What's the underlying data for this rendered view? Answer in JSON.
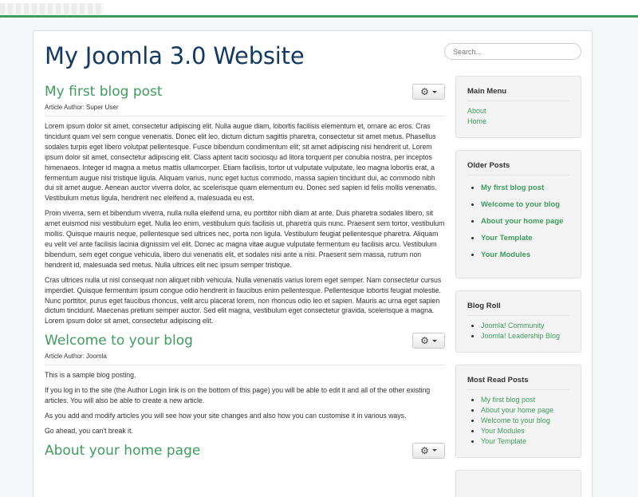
{
  "site": {
    "title": "My Joomla 3.0 Website"
  },
  "search": {
    "placeholder": "Search..."
  },
  "articles": [
    {
      "title": "My first blog post",
      "author": "Article Author: Super User",
      "paragraphs": [
        "Lorem ipsum dolor sit amet, consectetur adipiscing elit. Nulla augue diam, lobortis facilisis elementum et, ornare ac eros. Cras tincidunt quam vel sem congue venenatis. Donec elit leo, dictum dictum sagittis pharetra, consectetur sit amet metus. Phasellus sodales turpis eget libero volutpat pellentesque. Fusce bibendum condimentum elit; sit amet adipiscing nisi hendrerit ut. Lorem ipsum dolor sit amet, consectetur adipiscing elit. Class aptent taciti sociosqu ad litora torquent per conubia nostra, per inceptos himenaeos. Integer id magna a metus mattis ullamcorper. Etiam facilisis, tortor ut vulputate vulputate, leo magna lobortis erat, a fermentum augue nisi tristique ligula. Aliquam varius, nunc eget luctus commodo, massa sapien tincidunt dui, ac commodo nibh dui sit amet augue. Aenean auctor viverra dolor, ac scelerisque quam elementum eu. Donec sed sapien id felis mollis venenatis. Vestibulum metus ligula, hendrerit nec eleifend a, malesuada eu est.",
        "Proin viverra, sem et bibendum viverra, nulla nulla eleifend urna, eu porttitor nibh diam at ante. Duis pharetra sodales libero, sit amet euismod nisi vestibulum eget. Nulla leo enim, vestibulum quis facilisis ut, pharetra quis nunc. Praesent sem tortor, vestibulum mollis. Quisque mauris neque, pellentesque sed ultrices nec, porta non ligula. Vestibulum feugiat pellentesque pharetra. Aliquam eu velit vel ante facilisis lacinia dignissim vel elit. Donec ac magna vitae augue vulputate fermentum eu facilisis arcu. Vestibulum bibendum, sem eget congue vehicula, libero dui venenatis elit, et sodales nisi ante a nisi. Praesent sem massa, rutrum non hendrerit id, malesuada sed metus. Nulla ultrices elit nec ipsum semper tristique.",
        "Cras ultrices nulla ut nisl consequat non aliquet nibh vehicula. Nulla venenatis varius lorem eget semper. Nam consectetur cursus imperdiet. Quisque fermentum ipsum congue odio hendrerit in faucibus enim pellentesque. Pellentesque lobortis feugiat molestie. Nunc porttitor, purus eget faucibus rhoncus, velit arcu placerat lorem, non rhoncus odio leo et sapien. Mauris ac urna eget sapien dictum tincidunt. Maecenas pretium semper auctor. Sed elit magna, vestibulum eget consectetur gravida, scelerisque a magna. Lorem ipsum dolor sit amet, consectetur adipiscing elit."
      ]
    },
    {
      "title": "Welcome to your blog",
      "author": "Article Author: Joomla",
      "paragraphs": [
        "This is a sample blog posting.",
        "If you log in to the site (the Author Login link is on the bottom of this page) you will be able to edit it and all of the other existing articles. You will also be able to create a new article.",
        "As you add and modify articles you will see how your site changes and also how you can customise it in various ways.",
        "Go ahead, you can't break it."
      ]
    },
    {
      "title": "About your home page",
      "author": "",
      "paragraphs": []
    }
  ],
  "sidebar": {
    "main_menu": {
      "title": "Main Menu",
      "items": [
        "About",
        "Home"
      ]
    },
    "older_posts": {
      "title": "Older Posts",
      "items": [
        "My first blog post",
        "Welcome to your blog",
        "About your home page",
        "Your Template",
        "Your Modules"
      ]
    },
    "blog_roll": {
      "title": "Blog Roll",
      "items": [
        "Joomla! Community",
        "Joomla! Leadership Blog"
      ]
    },
    "most_read": {
      "title": "Most Read Posts",
      "items": [
        "My first blog post",
        "About your home page",
        "Welcome to your blog",
        "Your Modules",
        "Your Template"
      ]
    }
  },
  "icons": {
    "article_tools": "gear-icon",
    "dropdown": "caret-down-icon"
  },
  "colors": {
    "accent": "#3e9d5d",
    "title": "#133a64"
  }
}
